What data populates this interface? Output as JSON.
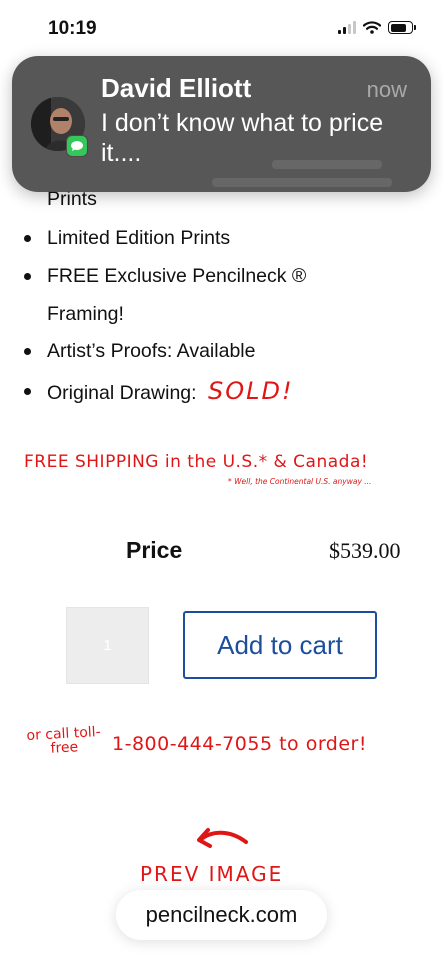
{
  "status_bar": {
    "time": "10:19"
  },
  "notification": {
    "sender": "David Elliott",
    "time": "now",
    "message": "I don’t know what to price it....",
    "app_icon": "messages-icon"
  },
  "product": {
    "bullets_partial": "Prints",
    "bullets": [
      "Limited Edition Prints",
      "FREE Exclusive Pencilneck ®",
      "Framing!",
      "Artist’s Proofs: Available",
      "Original Drawing:"
    ],
    "sold_label": "SOLD!",
    "free_shipping": "FREE SHIPPING in the U.S.* & Canada!",
    "shipping_note": "* Well, the Continental U.S. anyway ...",
    "price_label": "Price",
    "price_value": "$539.00",
    "quantity": "1",
    "add_to_cart_label": "Add to cart",
    "or_call": "or call toll-free",
    "phone": "1-800-444-7055 to order!",
    "prev_image_label": "PREV IMAGE"
  },
  "browser": {
    "url": "pencilneck.com"
  },
  "colors": {
    "accent_red": "#e01616",
    "button_blue": "#1c4e9c",
    "notification_bg": "#4a4a4a",
    "message_green": "#35c759"
  }
}
